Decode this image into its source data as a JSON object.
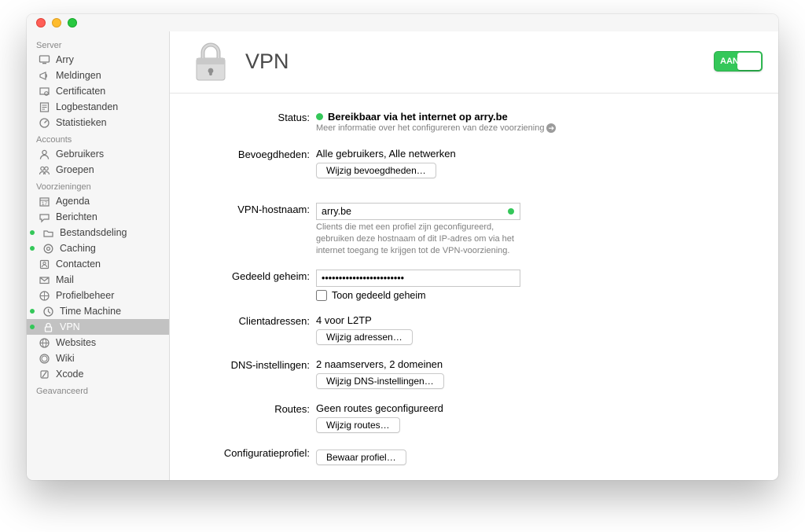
{
  "sidebar": {
    "sections": [
      {
        "title": "Server",
        "items": [
          {
            "label": "Arry",
            "icon": "monitor"
          },
          {
            "label": "Meldingen",
            "icon": "megaphone"
          },
          {
            "label": "Certificaten",
            "icon": "certificate"
          },
          {
            "label": "Logbestanden",
            "icon": "log"
          },
          {
            "label": "Statistieken",
            "icon": "gauge"
          }
        ]
      },
      {
        "title": "Accounts",
        "items": [
          {
            "label": "Gebruikers",
            "icon": "user"
          },
          {
            "label": "Groepen",
            "icon": "group"
          }
        ]
      },
      {
        "title": "Voorzieningen",
        "items": [
          {
            "label": "Agenda",
            "icon": "calendar"
          },
          {
            "label": "Berichten",
            "icon": "chat"
          },
          {
            "label": "Bestandsdeling",
            "icon": "folder",
            "dot": true
          },
          {
            "label": "Caching",
            "icon": "cache",
            "dot": true
          },
          {
            "label": "Contacten",
            "icon": "contacts"
          },
          {
            "label": "Mail",
            "icon": "mail"
          },
          {
            "label": "Profielbeheer",
            "icon": "profile"
          },
          {
            "label": "Time Machine",
            "icon": "tm",
            "dot": true
          },
          {
            "label": "VPN",
            "icon": "lock",
            "dot": true,
            "selected": true
          },
          {
            "label": "Websites",
            "icon": "globe"
          },
          {
            "label": "Wiki",
            "icon": "wiki"
          },
          {
            "label": "Xcode",
            "icon": "xcode"
          }
        ]
      },
      {
        "title": "Geavanceerd",
        "items": []
      }
    ]
  },
  "header": {
    "title": "VPN",
    "toggle_label": "AAN"
  },
  "status": {
    "label": "Status:",
    "text": "Bereikbaar via het internet op arry.be",
    "hint": "Meer informatie over het configureren van deze voorziening"
  },
  "permissions": {
    "label": "Bevoegdheden:",
    "value": "Alle gebruikers, Alle netwerken",
    "button": "Wijzig bevoegdheden…"
  },
  "hostname": {
    "label": "VPN-hostnaam:",
    "value": "arry.be",
    "hint": "Clients die met een profiel zijn geconfigureerd, gebruiken deze hostnaam of dit IP-adres om via het internet toegang te krijgen tot de VPN-voorziening."
  },
  "secret": {
    "label": "Gedeeld geheim:",
    "value": "••••••••••••••••••••••••",
    "checkbox": "Toon gedeeld geheim"
  },
  "clients": {
    "label": "Clientadressen:",
    "value": "4 voor L2TP",
    "button": "Wijzig adressen…"
  },
  "dns": {
    "label": "DNS-instellingen:",
    "value": "2 naamservers, 2 domeinen",
    "button": "Wijzig DNS-instellingen…"
  },
  "routes": {
    "label": "Routes:",
    "value": "Geen routes geconfigureerd",
    "button": "Wijzig routes…"
  },
  "profile": {
    "label": "Configuratieprofiel:",
    "button": "Bewaar profiel…"
  }
}
